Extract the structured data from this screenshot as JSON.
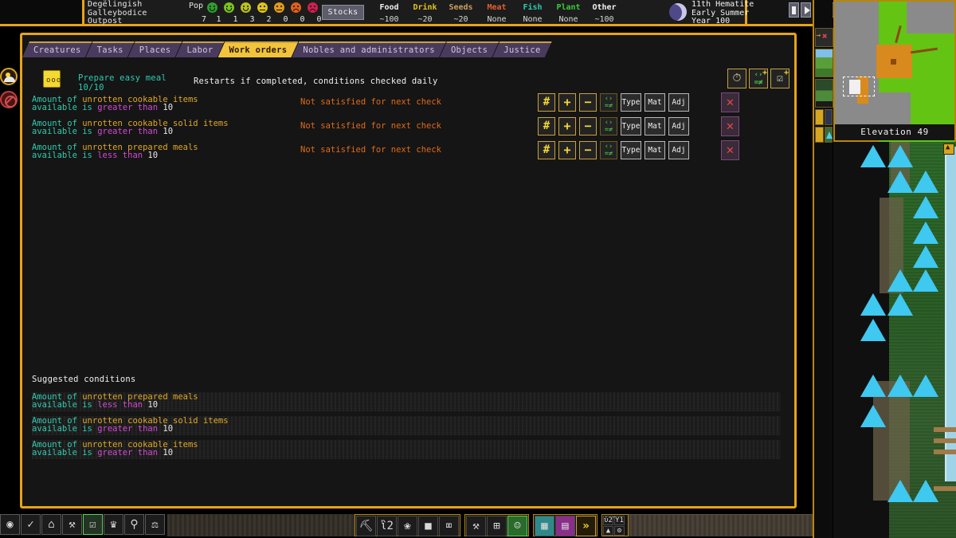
{
  "topbar": {
    "fort_name_line1": "Degëlingish",
    "fort_name_line2": "Galleybodice",
    "fort_name_line3": "Outpost",
    "pop_label": "Pop",
    "pop_total": "7",
    "mood_counts": [
      "1",
      "1",
      "3",
      "2",
      "0",
      "0",
      "0"
    ],
    "mood_colors": [
      "#2da02d",
      "#7ac41a",
      "#b8c41a",
      "#e0c41a",
      "#e09a1a",
      "#e0601a",
      "#d02050"
    ],
    "stocks_label": "Stocks",
    "stocks": [
      {
        "name": "Food",
        "value": "~100",
        "color": "#f0f0f0"
      },
      {
        "name": "Drink",
        "value": "~20",
        "color": "#e0c41a"
      },
      {
        "name": "Seeds",
        "value": "~20",
        "color": "#c8a060"
      },
      {
        "name": "Meat",
        "value": "None",
        "color": "#e06030"
      },
      {
        "name": "Fish",
        "value": "None",
        "color": "#2ecbb0"
      },
      {
        "name": "Plant",
        "value": "None",
        "color": "#3cc83c"
      },
      {
        "name": "Other",
        "value": "~100",
        "color": "#f0f0f0"
      }
    ],
    "date_line1": "11th Hematite",
    "date_line2": "Early Summer",
    "date_line3": "Year 100",
    "moon_icon": "moon-icon",
    "win_pause": "pause-icon",
    "win_play": "play-icon",
    "win_gear": "gear-icon",
    "win_help": "?"
  },
  "tabs": [
    {
      "label": "Creatures",
      "active": false
    },
    {
      "label": "Tasks",
      "active": false
    },
    {
      "label": "Places",
      "active": false
    },
    {
      "label": "Labor",
      "active": false
    },
    {
      "label": "Work orders",
      "active": true
    },
    {
      "label": "Nobles and administrators",
      "active": false
    },
    {
      "label": "Objects",
      "active": false
    },
    {
      "label": "Justice",
      "active": false
    }
  ],
  "work_order": {
    "icon_glyph": "ooo",
    "title": "Prepare easy meal",
    "progress": "10/10",
    "restart_note": "Restarts if completed, conditions checked daily",
    "tools": [
      {
        "name": "frequency-clock-button",
        "glyph": "⏱",
        "plus": ""
      },
      {
        "name": "add-condition-button",
        "line1": "‹›",
        "line2": "=≠",
        "plus": "+"
      },
      {
        "name": "add-suggested-conditions-button",
        "glyph": "ὌB",
        "plus": "+"
      }
    ],
    "button_labels": {
      "amount": "#",
      "increase": "+",
      "decrease": "−",
      "comparison_l1": "‹›",
      "comparison_l2": "=≠",
      "type": "Type",
      "material": "Mat",
      "adjective": "Adj",
      "delete": "✕"
    },
    "conditions": [
      {
        "prefix": "Amount of",
        "item": "unrotten cookable items",
        "available": "available is",
        "operator": "greater than",
        "value": "10",
        "status": "Not satisfied for next check"
      },
      {
        "prefix": "Amount of",
        "item": "unrotten cookable solid items",
        "available": "available is",
        "operator": "greater than",
        "value": "10",
        "status": "Not satisfied for next check"
      },
      {
        "prefix": "Amount of",
        "item": "unrotten prepared meals",
        "available": "available is",
        "operator": "less than",
        "value": "10",
        "status": "Not satisfied for next check"
      }
    ],
    "suggested_title": "Suggested conditions",
    "suggested": [
      {
        "prefix": "Amount of",
        "item": "unrotten prepared meals",
        "available": "available is",
        "operator": "less than",
        "value": "10"
      },
      {
        "prefix": "Amount of",
        "item": "unrotten cookable solid items",
        "available": "available is",
        "operator": "greater than",
        "value": "10"
      },
      {
        "prefix": "Amount of",
        "item": "unrotten cookable items",
        "available": "available is",
        "operator": "greater than",
        "value": "10"
      }
    ]
  },
  "minimap": {
    "elevation_label": "Elevation 49"
  },
  "left_icons": [
    {
      "name": "weather-icon"
    },
    {
      "name": "no-entry-icon"
    }
  ],
  "bottom_left_toolbar": [
    {
      "name": "dwarf-head-icon",
      "glyph": "◉",
      "selected": false
    },
    {
      "name": "tasks-scroll-icon",
      "glyph": "✓",
      "selected": false
    },
    {
      "name": "places-building-icon",
      "glyph": "⌂",
      "selected": false
    },
    {
      "name": "labor-hammer-icon",
      "glyph": "⚒",
      "selected": false
    },
    {
      "name": "work-orders-clipboard-icon",
      "glyph": "☑",
      "selected": true
    },
    {
      "name": "nobles-crown-icon",
      "glyph": "♛",
      "selected": false
    },
    {
      "name": "objects-amulet-icon",
      "glyph": "⚲",
      "selected": false
    },
    {
      "name": "justice-scales-icon",
      "glyph": "⚖",
      "selected": false
    }
  ],
  "bottom_center_toolbar": {
    "group1": [
      {
        "name": "mine-pick-icon",
        "glyph": "⛏"
      },
      {
        "name": "chop-trees-icon",
        "glyph": "ἳ2"
      },
      {
        "name": "gather-plants-icon",
        "glyph": "❀"
      },
      {
        "name": "smooth-stone-icon",
        "glyph": "■"
      },
      {
        "name": "erase-designation-icon",
        "glyph": "⌧"
      }
    ],
    "group2": [
      {
        "name": "build-workshop-icon",
        "glyph": "⚒"
      },
      {
        "name": "build-furniture-icon",
        "glyph": "⊞"
      },
      {
        "name": "squads-icon",
        "glyph": "☺",
        "green": true
      }
    ],
    "group3": [
      {
        "name": "zones-icon",
        "glyph": "▦",
        "style": "grid1"
      },
      {
        "name": "stockpiles-icon",
        "glyph": "▤",
        "style": "grid2"
      },
      {
        "name": "more-options-icon",
        "glyph": "»",
        "style": "chev"
      }
    ],
    "group4": [
      {
        "name": "lock-icon",
        "glyph": "ὑ2"
      },
      {
        "name": "trash-icon",
        "glyph": "Ὕ1"
      },
      {
        "name": "fire-icon",
        "glyph": "▲"
      },
      {
        "name": "gear-small-icon",
        "glyph": "⚙"
      }
    ]
  }
}
